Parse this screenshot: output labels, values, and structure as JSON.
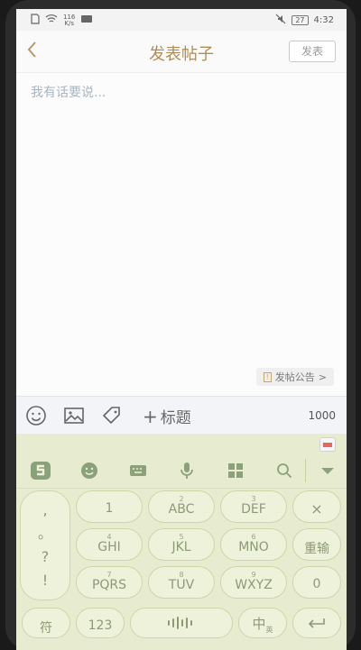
{
  "status_bar": {
    "network_speed": "116",
    "network_unit": "K/s",
    "battery": "27",
    "time": "4:32"
  },
  "header": {
    "back_icon": "chevron-left-icon",
    "title": "发表帖子",
    "publish_label": "发表"
  },
  "editor": {
    "placeholder": "我有话要说...",
    "notice_label": "发帖公告",
    "notice_arrow": ">"
  },
  "toolbar": {
    "add_title_label": "标题",
    "char_count": "1000",
    "icons": [
      "emoji-icon",
      "image-icon",
      "tag-icon"
    ]
  },
  "keyboard": {
    "symbols": [
      ",",
      "。",
      "?",
      "!"
    ],
    "keys": [
      {
        "num": "",
        "letters": "1"
      },
      {
        "num": "2",
        "letters": "ABC"
      },
      {
        "num": "3",
        "letters": "DEF"
      },
      {
        "num": "4",
        "letters": "GHI"
      },
      {
        "num": "5",
        "letters": "JKL"
      },
      {
        "num": "6",
        "letters": "MNO"
      },
      {
        "num": "7",
        "letters": "PQRS"
      },
      {
        "num": "8",
        "letters": "TUV"
      },
      {
        "num": "9",
        "letters": "WXYZ"
      }
    ],
    "delete_label": "×",
    "reinput_label": "重输",
    "zero_label": "0",
    "symbol_key_label": "符",
    "num_key_label": "123",
    "lang_main": "中",
    "lang_sub": "英",
    "colors": {
      "keyboard_bg": "#e7ecd1",
      "accent": "#b08d58"
    }
  }
}
